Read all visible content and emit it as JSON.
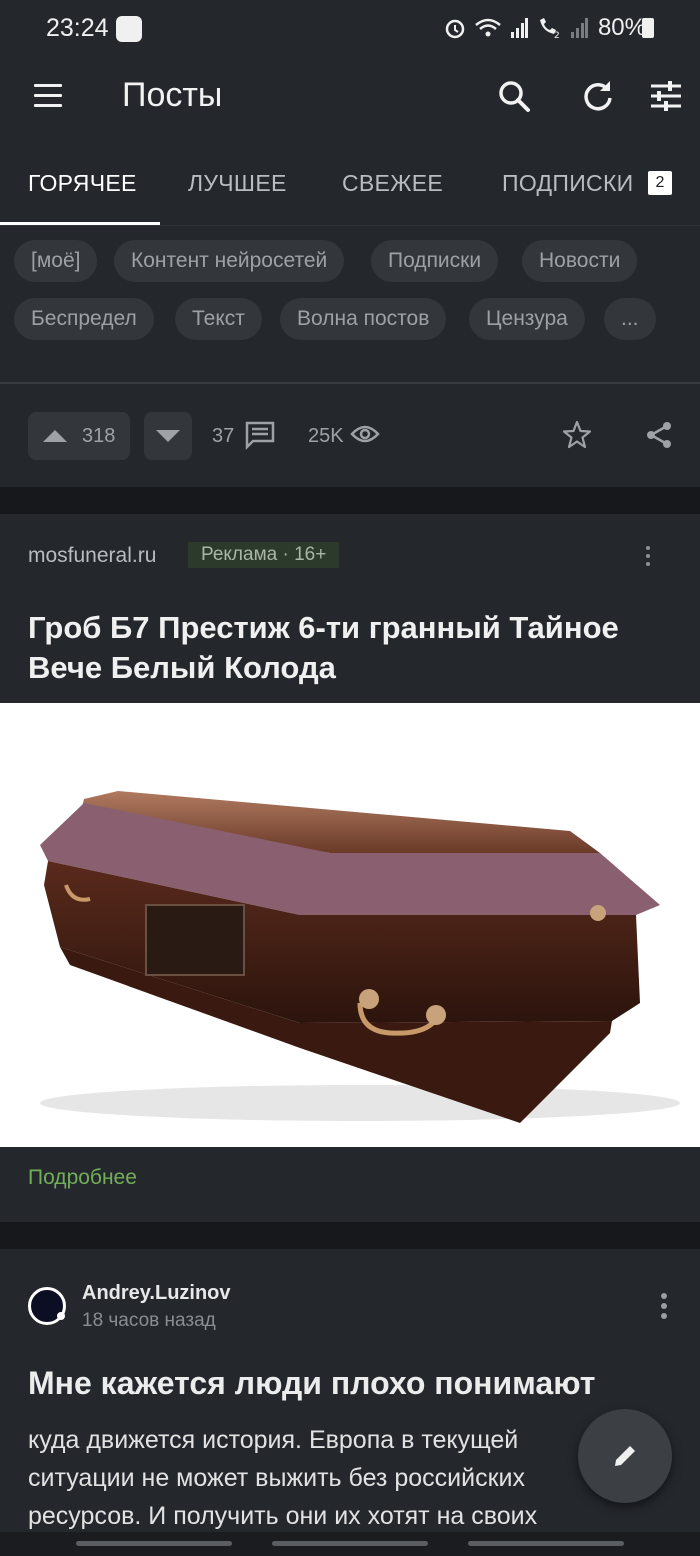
{
  "status_bar": {
    "time": "23:24",
    "battery": "80%",
    "icons": [
      "app-notification-icon",
      "alarm-icon",
      "wifi-icon",
      "signal-icon",
      "call-signal-icon",
      "signal-icon",
      "battery-icon"
    ]
  },
  "app_bar": {
    "title": "Посты",
    "icons": [
      "menu-icon",
      "search-icon",
      "refresh-icon",
      "filter-icon"
    ]
  },
  "tabs": [
    {
      "label": "ГОРЯЧЕЕ",
      "active": true
    },
    {
      "label": "ЛУЧШЕЕ",
      "active": false
    },
    {
      "label": "СВЕЖЕЕ",
      "active": false
    },
    {
      "label": "ПОДПИСКИ",
      "active": false,
      "badge": "2"
    }
  ],
  "chips": [
    "[моё]",
    "Контент нейросетей",
    "Подписки",
    "Новости",
    "Беспредел",
    "Текст",
    "Волна постов",
    "Цензура",
    "..."
  ],
  "prev_post_actions": {
    "rating": "318",
    "comments": "37",
    "views": "25K"
  },
  "ad": {
    "source": "mosfuneral.ru",
    "badge": "Реклама · 16+",
    "headline": "Гроб Б7 Престиж 6-ти гранный Тайное Вече Белый Колода",
    "more_link": "Подробнее"
  },
  "post": {
    "author": "Andrey.Luzinov",
    "time_ago": "18 часов назад",
    "title": "Мне кажется люди плохо понимают",
    "body_lines": [
      "куда движется история. Европа в текущей",
      "ситуации не может выжить без российских",
      "ресурсов. И получить они их хотят на своих"
    ]
  },
  "colors": {
    "background": "#1e2125",
    "surface": "#24282d",
    "chip": "#33373c",
    "link_green": "#72ae5a",
    "text": "#e8e8e8"
  }
}
